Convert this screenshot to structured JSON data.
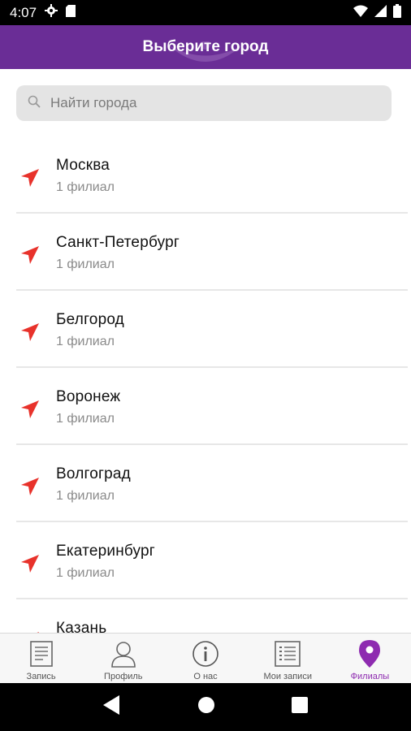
{
  "status_bar": {
    "time": "4:07"
  },
  "header": {
    "title": "Выберите город"
  },
  "search": {
    "placeholder": "Найти города",
    "value": ""
  },
  "cities": [
    {
      "name": "Москва",
      "count": "1 филиал"
    },
    {
      "name": "Санкт-Петербург",
      "count": "1 филиал"
    },
    {
      "name": "Белгород",
      "count": "1 филиал"
    },
    {
      "name": "Воронеж",
      "count": "1 филиал"
    },
    {
      "name": "Волгоград",
      "count": "1 филиал"
    },
    {
      "name": "Екатеринбург",
      "count": "1 филиал"
    },
    {
      "name": "Казань",
      "count": ""
    }
  ],
  "bottom_nav": {
    "tabs": [
      {
        "label": "Запись",
        "icon": "document-icon"
      },
      {
        "label": "Профиль",
        "icon": "person-icon"
      },
      {
        "label": "О нас",
        "icon": "info-icon"
      },
      {
        "label": "Мои записи",
        "icon": "list-icon"
      },
      {
        "label": "Филиалы",
        "icon": "location-pin-icon",
        "active": true
      }
    ]
  },
  "colors": {
    "header_bg": "#6a2d96",
    "accent": "#8e2bb0",
    "nav_arrow": "#e8322b"
  }
}
